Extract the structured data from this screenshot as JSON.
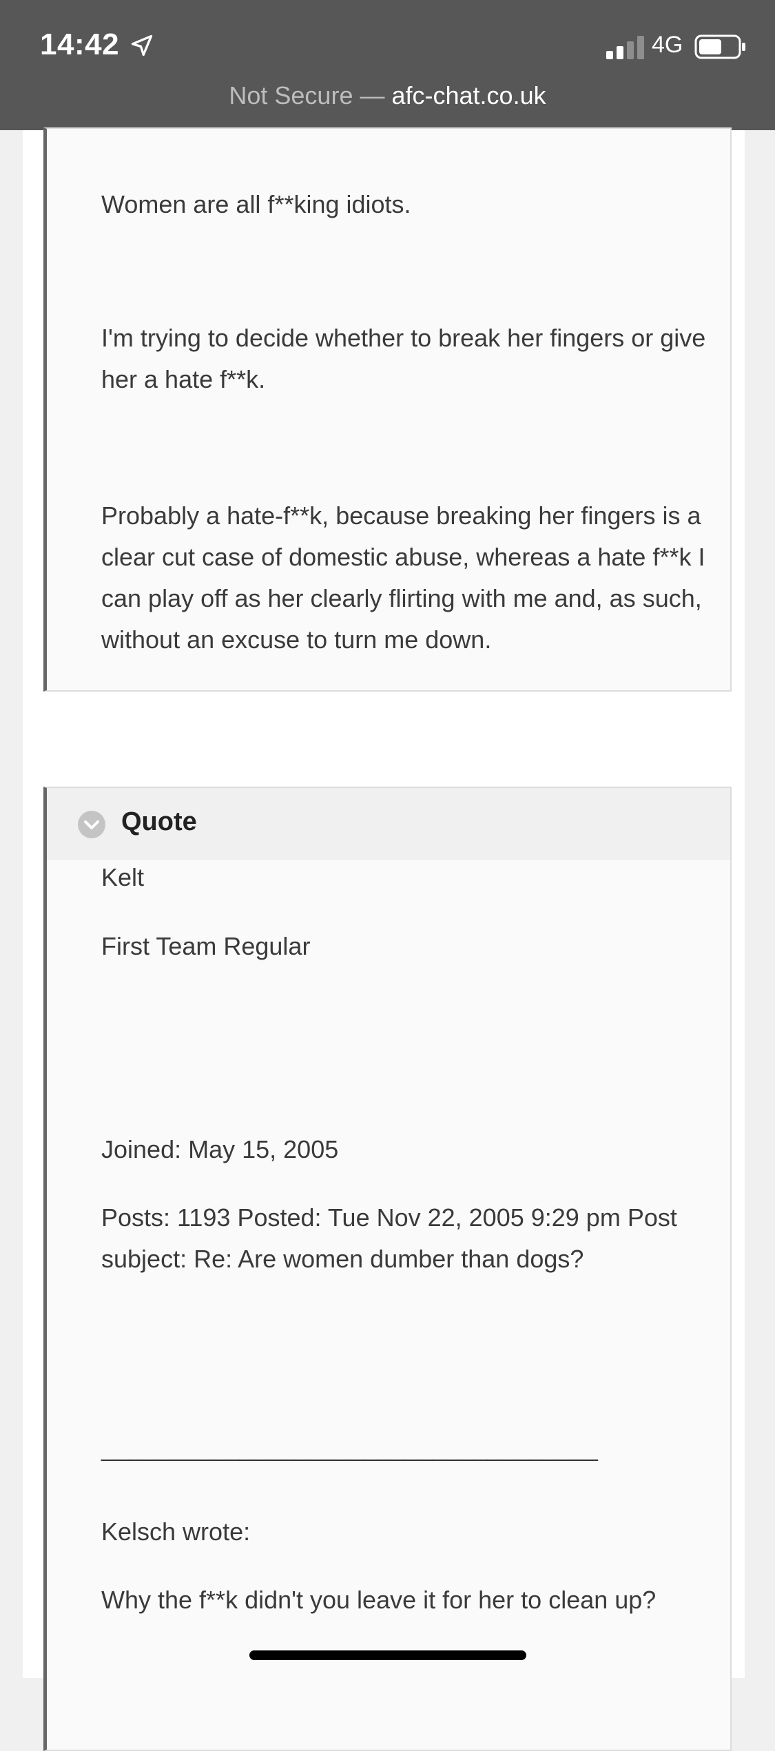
{
  "status_bar": {
    "time": "14:42",
    "network": "4G",
    "location_icon": "location-arrow-icon",
    "signal_icon": "cellular-signal-icon",
    "battery_icon": "battery-icon"
  },
  "address_bar": {
    "security": "Not Secure",
    "separator": "—",
    "domain": "afc-chat.co.uk"
  },
  "quote1": {
    "paragraphs": [
      "Women are all f**king idiots.",
      "I'm trying to decide whether to break her fingers or give her a hate f**k.",
      "Probably a hate-f**k, because breaking her fingers is a clear cut case of domestic abuse, whereas a hate f**k I can play off as her clearly flirting with me and, as such, without an excuse to turn me down."
    ]
  },
  "quote2": {
    "header": "Quote",
    "chevron_icon": "chevron-down-circle-icon",
    "username": "Kelt",
    "rank": "First Team Regular",
    "joined": "Joined: May 15, 2005",
    "posts_line": "Posts: 1193 Posted: Tue Nov 22, 2005 9:29 pm Post subject: Re: Are women dumber than dogs?",
    "signature_rule": "____________________________________",
    "quoted_author": "Kelsch wrote:",
    "quoted_text": "Why the f**k didn't you leave it for her to clean up?"
  },
  "colors": {
    "status_bar_bg": "#575757",
    "quote_bg": "#fafafa",
    "quote_border": "#666666",
    "quote_header_bg": "#f0f0f0"
  }
}
